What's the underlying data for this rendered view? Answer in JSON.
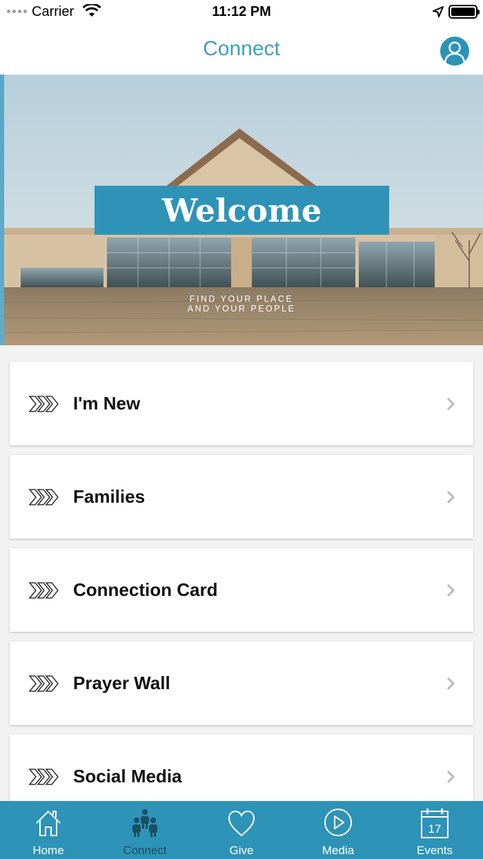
{
  "status_bar": {
    "carrier": "Carrier",
    "time": "11:12 PM"
  },
  "nav": {
    "title": "Connect"
  },
  "hero": {
    "welcome": "Welcome",
    "tagline_line1": "FIND YOUR PLACE",
    "tagline_line2": "AND YOUR PEOPLE"
  },
  "menu": {
    "items": [
      {
        "label": "I'm New"
      },
      {
        "label": "Families"
      },
      {
        "label": "Connection Card"
      },
      {
        "label": "Prayer Wall"
      },
      {
        "label": "Social Media"
      }
    ]
  },
  "tabs": {
    "items": [
      {
        "label": "Home",
        "icon": "home-icon"
      },
      {
        "label": "Connect",
        "icon": "people-icon",
        "active": true
      },
      {
        "label": "Give",
        "icon": "heart-icon"
      },
      {
        "label": "Media",
        "icon": "play-icon"
      },
      {
        "label": "Events",
        "icon": "calendar-icon",
        "badge": "17"
      }
    ]
  },
  "colors": {
    "accent": "#2d93b7",
    "title": "#3a9fbf",
    "active_tab_label": "#1b4e63"
  }
}
